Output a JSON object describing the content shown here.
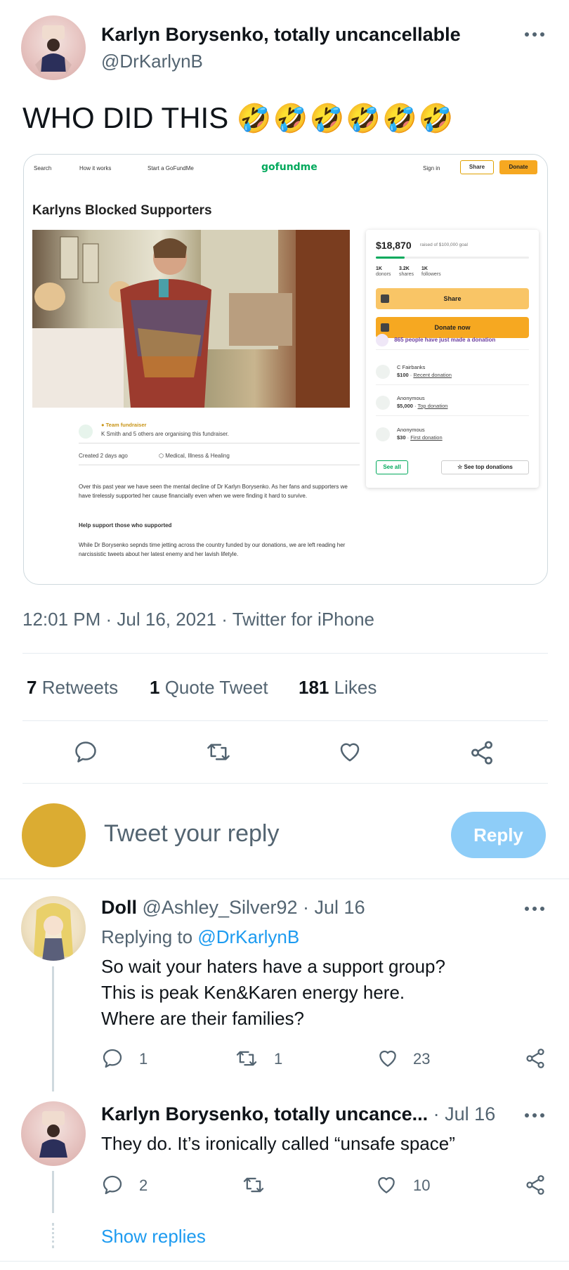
{
  "tweet": {
    "author_name": "Karlyn Borysenko, totally uncancellable",
    "author_handle": "@DrKarlynB",
    "text": "WHO DID THIS",
    "emoji": "🤣🤣🤣🤣🤣🤣",
    "timestamp": "12:01 PM · Jul 16, 2021 · Twitter for iPhone",
    "stats": {
      "retweets_count": "7",
      "retweets_label": "Retweets",
      "quotes_count": "1",
      "quotes_label": "Quote Tweet",
      "likes_count": "181",
      "likes_label": "Likes"
    }
  },
  "embed": {
    "nav": {
      "search": "Search",
      "how_it_works": "How it works",
      "start": "Start a GoFundMe",
      "logo": "gofundme",
      "sign_in": "Sign in",
      "share": "Share",
      "donate": "Donate"
    },
    "title": "Karlyns Blocked Supporters",
    "raised": "$18,870",
    "goal": "raised of $100,000 goal",
    "progress_fraction": 0.1887,
    "stats": [
      {
        "value": "1K",
        "label": "donors"
      },
      {
        "value": "3.2K",
        "label": "shares"
      },
      {
        "value": "1K",
        "label": "followers"
      }
    ],
    "share_btn": "Share",
    "donate_btn": "Donate now",
    "recent_note": "865 people have just made a donation",
    "donations": [
      {
        "name": "C Fairbanks",
        "amount": "$100",
        "tag": "Recent donation"
      },
      {
        "name": "Anonymous",
        "amount": "$5,000",
        "tag": "Top donation"
      },
      {
        "name": "Anonymous",
        "amount": "$30",
        "tag": "First donation"
      }
    ],
    "see_all": "See all",
    "see_top": "See top donations",
    "team_label": "Team fundraiser",
    "organisers": "K Smith and 5 others are organising this fundraiser.",
    "created": "Created 2 days ago",
    "category": "Medical, Illness & Healing",
    "paragraph1": "Over this past year we have seen the mental decline of Dr Karlyn Borysenko. As her fans and supporters we have tirelessly supported her cause financially even when we were finding it hard to survive.",
    "heading": "Help support those who supported",
    "paragraph2": "While Dr Borysenko sepnds time jetting across the country funded by our donations, we are left reading her narcissistic tweets about her latest enemy and her lavish lifetyle."
  },
  "compose": {
    "placeholder": "Tweet your reply",
    "reply_button": "Reply"
  },
  "replies": [
    {
      "name": "Doll",
      "handle": "@Ashley_Silver92",
      "date": "· Jul 16",
      "replying_prefix": "Replying to",
      "replying_to": "@DrKarlynB",
      "lines": [
        "So wait your haters have a support group?",
        "This is peak Ken&Karen energy here.",
        "Where are their families?"
      ],
      "replies": "1",
      "retweets": "1",
      "likes": "23"
    },
    {
      "name": "Karlyn Borysenko, totally uncance...",
      "date": "· Jul 16",
      "text": "They do. It’s ironically called “unsafe space”",
      "replies": "2",
      "retweets": "",
      "likes": "10"
    }
  ],
  "show_replies": "Show replies",
  "icons": [
    "reply-icon",
    "retweet-icon",
    "like-icon",
    "share-icon",
    "more-icon"
  ]
}
